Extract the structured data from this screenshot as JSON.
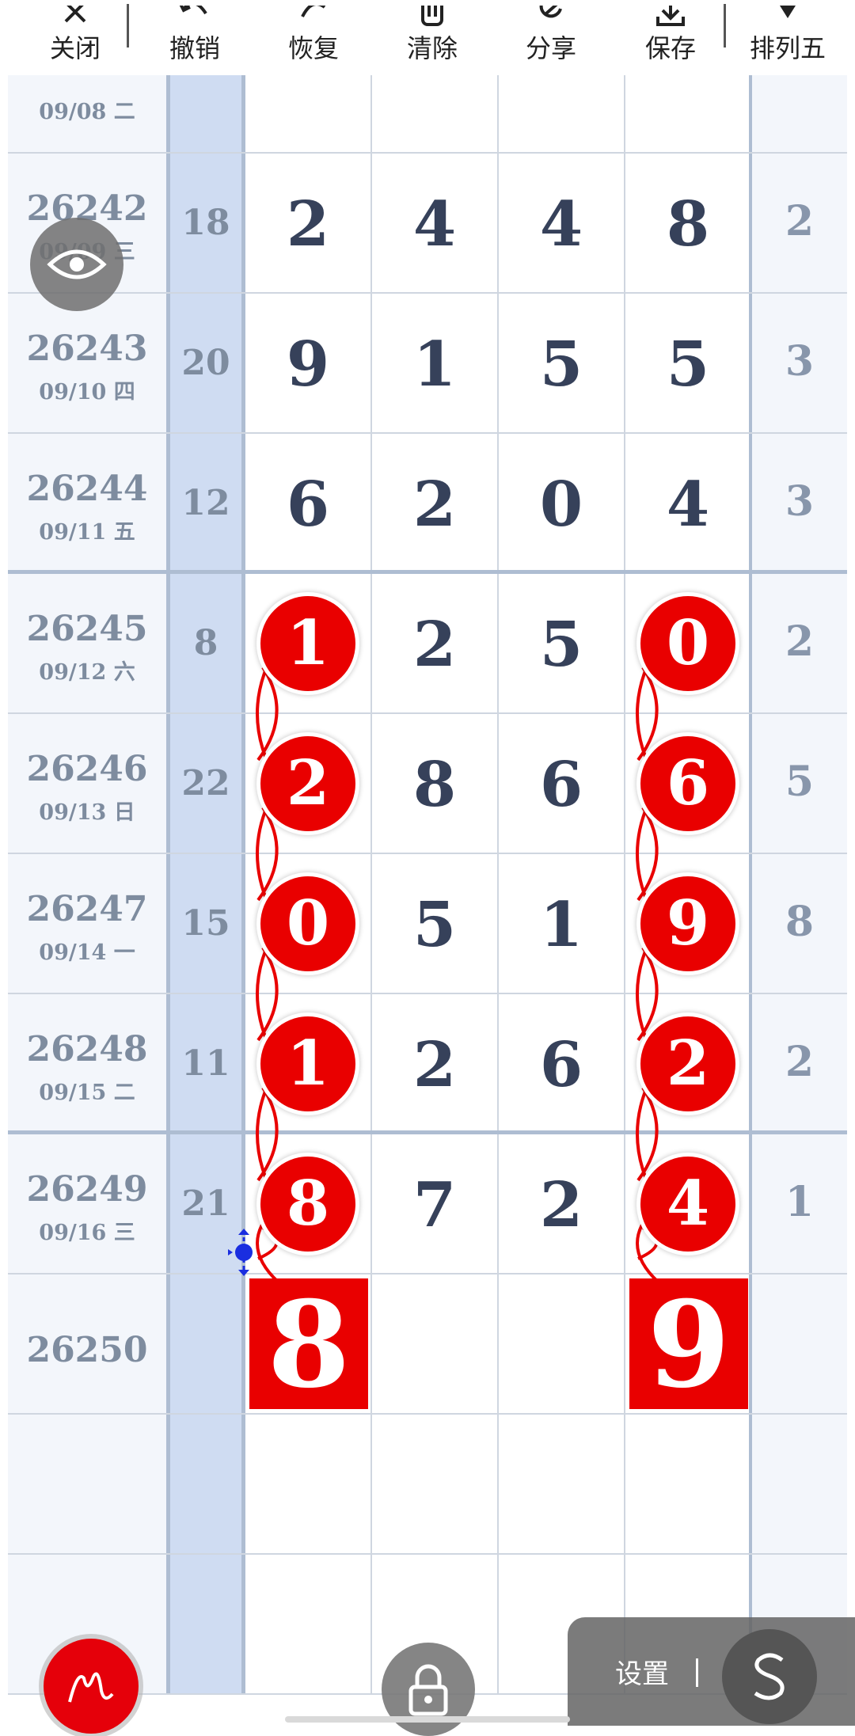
{
  "toolbar": {
    "items": [
      {
        "label": "关闭",
        "icon": "close-icon"
      },
      {
        "label": "撤销",
        "icon": "undo-icon"
      },
      {
        "label": "恢复",
        "icon": "redo-icon"
      },
      {
        "label": "清除",
        "icon": "trash-icon"
      },
      {
        "label": "分享",
        "icon": "share-icon"
      },
      {
        "label": "保存",
        "icon": "download-icon"
      },
      {
        "label": "排列五",
        "icon": "dropdown-icon"
      }
    ]
  },
  "rows": [
    {
      "issue": "",
      "date": "09/08 二",
      "sum": "",
      "digits": [
        "",
        "",
        "",
        ""
      ],
      "span": "",
      "partial": true
    },
    {
      "issue": "26242",
      "date": "09/09 三",
      "sum": "18",
      "digits": [
        "2",
        "4",
        "4",
        "8"
      ],
      "span": "2"
    },
    {
      "issue": "26243",
      "date": "09/10 四",
      "sum": "20",
      "digits": [
        "9",
        "1",
        "5",
        "5"
      ],
      "span": "3"
    },
    {
      "issue": "26244",
      "date": "09/11 五",
      "sum": "12",
      "digits": [
        "6",
        "2",
        "0",
        "4"
      ],
      "span": "3"
    },
    {
      "issue": "26245",
      "date": "09/12 六",
      "sum": "8",
      "digits": [
        "1",
        "2",
        "5",
        "0"
      ],
      "span": "2"
    },
    {
      "issue": "26246",
      "date": "09/13 日",
      "sum": "22",
      "digits": [
        "2",
        "8",
        "6",
        "6"
      ],
      "span": "5"
    },
    {
      "issue": "26247",
      "date": "09/14 一",
      "sum": "15",
      "digits": [
        "0",
        "5",
        "1",
        "9"
      ],
      "span": "8"
    },
    {
      "issue": "26248",
      "date": "09/15 二",
      "sum": "11",
      "digits": [
        "1",
        "2",
        "6",
        "2"
      ],
      "span": "2"
    },
    {
      "issue": "26249",
      "date": "09/16 三",
      "sum": "21",
      "digits": [
        "8",
        "7",
        "2",
        "4"
      ],
      "span": "1"
    },
    {
      "issue": "26250",
      "date": "",
      "sum": "",
      "digits": [
        "8",
        "",
        "",
        "9"
      ],
      "span": "",
      "prediction": true
    },
    {
      "issue": "",
      "date": "",
      "sum": "",
      "digits": [
        "",
        "",
        "",
        ""
      ],
      "span": ""
    },
    {
      "issue": "",
      "date": "",
      "sum": "",
      "digits": [
        "",
        "",
        "",
        ""
      ],
      "span": ""
    }
  ],
  "highlight": {
    "columns": [
      0,
      3
    ],
    "ball_rows": [
      4,
      5,
      6,
      7,
      8
    ],
    "prediction_row": 9,
    "ball_color": "#e90000"
  },
  "section_break_after_rows": [
    3,
    7
  ],
  "overlays": {
    "settings_label": "设置",
    "settings_button_icon": "s-curve-icon",
    "eye_icon": "eye-icon",
    "pen_icon": "pen-icon",
    "lock_icon": "lock-icon"
  },
  "colors": {
    "accent_red": "#e90000",
    "sum_column": "#cfdcf2",
    "digit_text": "#36415a",
    "muted_text": "#7e8c9f"
  }
}
